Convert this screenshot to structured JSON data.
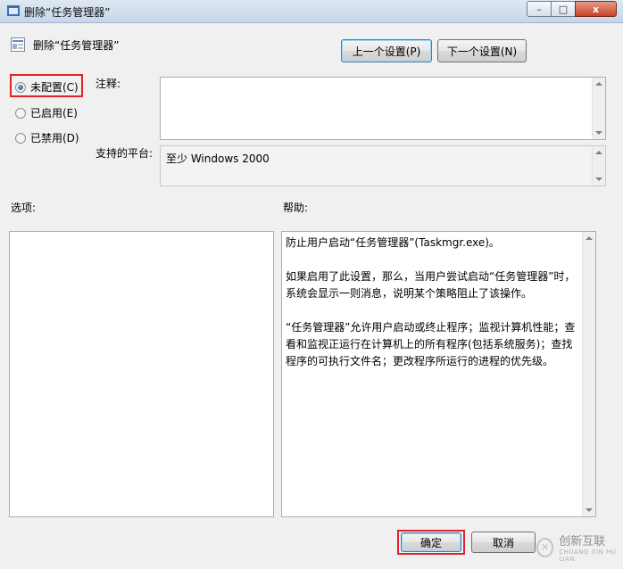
{
  "window": {
    "title": "删除“任务管理器”",
    "minimize_glyph": "–",
    "maximize_glyph": "□",
    "close_glyph": "x"
  },
  "header": {
    "policy_title": "删除“任务管理器”",
    "prev_setting": "上一个设置(P)",
    "next_setting": "下一个设置(N)"
  },
  "state": {
    "options": [
      {
        "label": "未配置(C)",
        "checked": true
      },
      {
        "label": "已启用(E)",
        "checked": false
      },
      {
        "label": "已禁用(D)",
        "checked": false
      }
    ]
  },
  "comment": {
    "label": "注释:",
    "value": ""
  },
  "platform": {
    "label": "支持的平台:",
    "value": "至少 Windows 2000"
  },
  "options_section": {
    "label": "选项:"
  },
  "help_section": {
    "label": "帮助:",
    "paragraphs": [
      "防止用户启动“任务管理器”(Taskmgr.exe)。",
      "如果启用了此设置，那么，当用户尝试启动“任务管理器”时，系统会显示一则消息，说明某个策略阻止了该操作。",
      "“任务管理器”允许用户启动或终止程序；监视计算机性能；查看和监视正运行在计算机上的所有程序(包括系统服务)；查找程序的可执行文件名；更改程序所运行的进程的优先级。"
    ]
  },
  "footer": {
    "ok": "确定",
    "cancel": "取消"
  },
  "watermark": {
    "text": "创新互联",
    "sub": "CHUANG XIN HU LIAN"
  }
}
